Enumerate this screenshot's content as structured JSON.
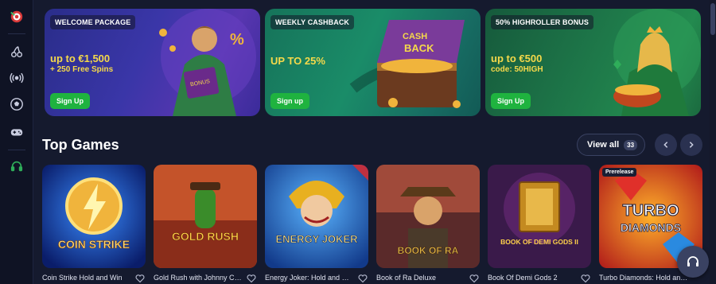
{
  "sidebar": {
    "items": [
      {
        "name": "logo",
        "icon": "target-logo-icon"
      },
      {
        "name": "casino",
        "icon": "cherry-icon"
      },
      {
        "name": "live",
        "icon": "broadcast-icon"
      },
      {
        "name": "sports",
        "icon": "soccer-ball-icon"
      },
      {
        "name": "esports",
        "icon": "gamepad-icon"
      },
      {
        "name": "support",
        "icon": "headset-icon"
      }
    ]
  },
  "promos": [
    {
      "tag": "WELCOME PACKAGE",
      "headline": "up to €1,500",
      "sub": "+ 250 Free Spins",
      "cta": "Sign Up"
    },
    {
      "tag": "WEEKLY CASHBACK",
      "headline": "UP TO 25%",
      "sub": "",
      "cta": "Sign up"
    },
    {
      "tag": "50% HIGHROLLER BONUS",
      "headline": "up to €500",
      "sub": "code: 50HIGH",
      "cta": "Sign Up"
    }
  ],
  "section": {
    "title": "Top Games",
    "view_all_label": "View all",
    "view_all_count": "33"
  },
  "games": [
    {
      "title": "Coin Strike Hold and Win",
      "art_text": "COIN STRIKE",
      "badge": ""
    },
    {
      "title": "Gold Rush with Johnny Cash",
      "art_text": "GOLD RUSH",
      "badge": ""
    },
    {
      "title": "Energy Joker: Hold and Win",
      "art_text": "ENERGY JOKER",
      "badge": ""
    },
    {
      "title": "Book of Ra Deluxe",
      "art_text": "BOOK OF RA",
      "badge": ""
    },
    {
      "title": "Book Of Demi Gods 2",
      "art_text": "BOOK OF DEMI GODS II",
      "badge": ""
    },
    {
      "title": "Turbo Diamonds: Hold and Win",
      "art_text": "TURBO DIAMONDS",
      "badge": "Prerelease"
    }
  ],
  "colors": {
    "background": "#151a2e",
    "sidebar": "#0f1324",
    "accent_green": "#1fb33f",
    "promo_yellow": "#f5d94a"
  }
}
